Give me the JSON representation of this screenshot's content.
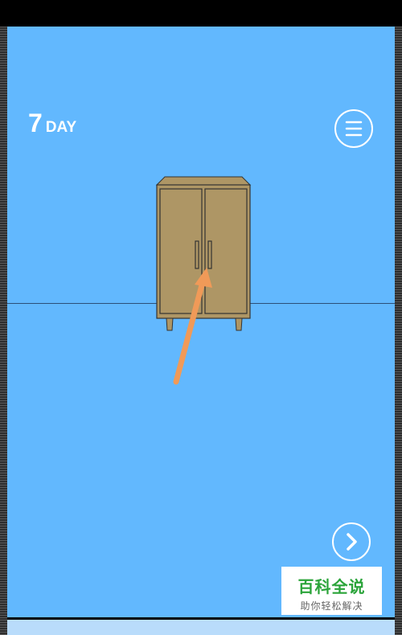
{
  "hud": {
    "day_number": "7",
    "day_label": "DAY"
  },
  "buttons": {
    "menu_icon": "hamburger-icon",
    "next_icon": "chevron-right-icon"
  },
  "scene": {
    "object": "wooden-cabinet",
    "hint": "arrow-pointing-to-right-door-handle"
  },
  "watermark": {
    "logo": "百科全说",
    "tagline": "助你轻松解决"
  },
  "colors": {
    "sky": "#62b8fe",
    "cabinet": "#ae9665",
    "arrow": "#f09a58",
    "watermark_green": "#2ba43a"
  }
}
